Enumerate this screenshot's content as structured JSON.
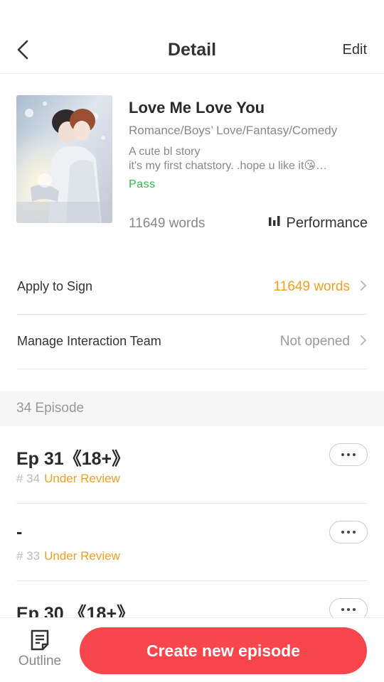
{
  "header": {
    "title": "Detail",
    "edit_label": "Edit"
  },
  "story": {
    "title": "Love Me Love You",
    "genres": "Romance/Boys’ Love/Fantasy/Comedy",
    "description_line1": "A cute bl story",
    "description_line2": "it's my first chatstory. .hope u like it😘…",
    "status": "Pass",
    "words": "11649 words",
    "performance_label": "Performance"
  },
  "rows": {
    "apply_sign": {
      "label": "Apply to Sign",
      "value": "11649 words"
    },
    "interaction_team": {
      "label": "Manage Interaction Team",
      "value": "Not opened"
    }
  },
  "episodes_header": "34 Episode",
  "episodes": [
    {
      "title": "Ep 31《18+》",
      "num": "# 34",
      "status": "Under Review"
    },
    {
      "title": "-",
      "num": "# 33",
      "status": "Under Review"
    },
    {
      "title": "Ep 30 《18+》",
      "num": "",
      "status": ""
    }
  ],
  "bottom": {
    "outline_label": "Outline",
    "create_label": "Create new episode"
  },
  "colors": {
    "accent_red": "#f9454c",
    "status_orange": "#f0a020",
    "pass_green": "#2bbb4a",
    "row_value_orange": "#f0a020",
    "row_value_grey": "#999999"
  },
  "icons": {
    "back": "chevron-left-icon",
    "performance": "bar-chart-icon",
    "more": "more-horizontal-icon",
    "outline": "document-lines-icon"
  }
}
